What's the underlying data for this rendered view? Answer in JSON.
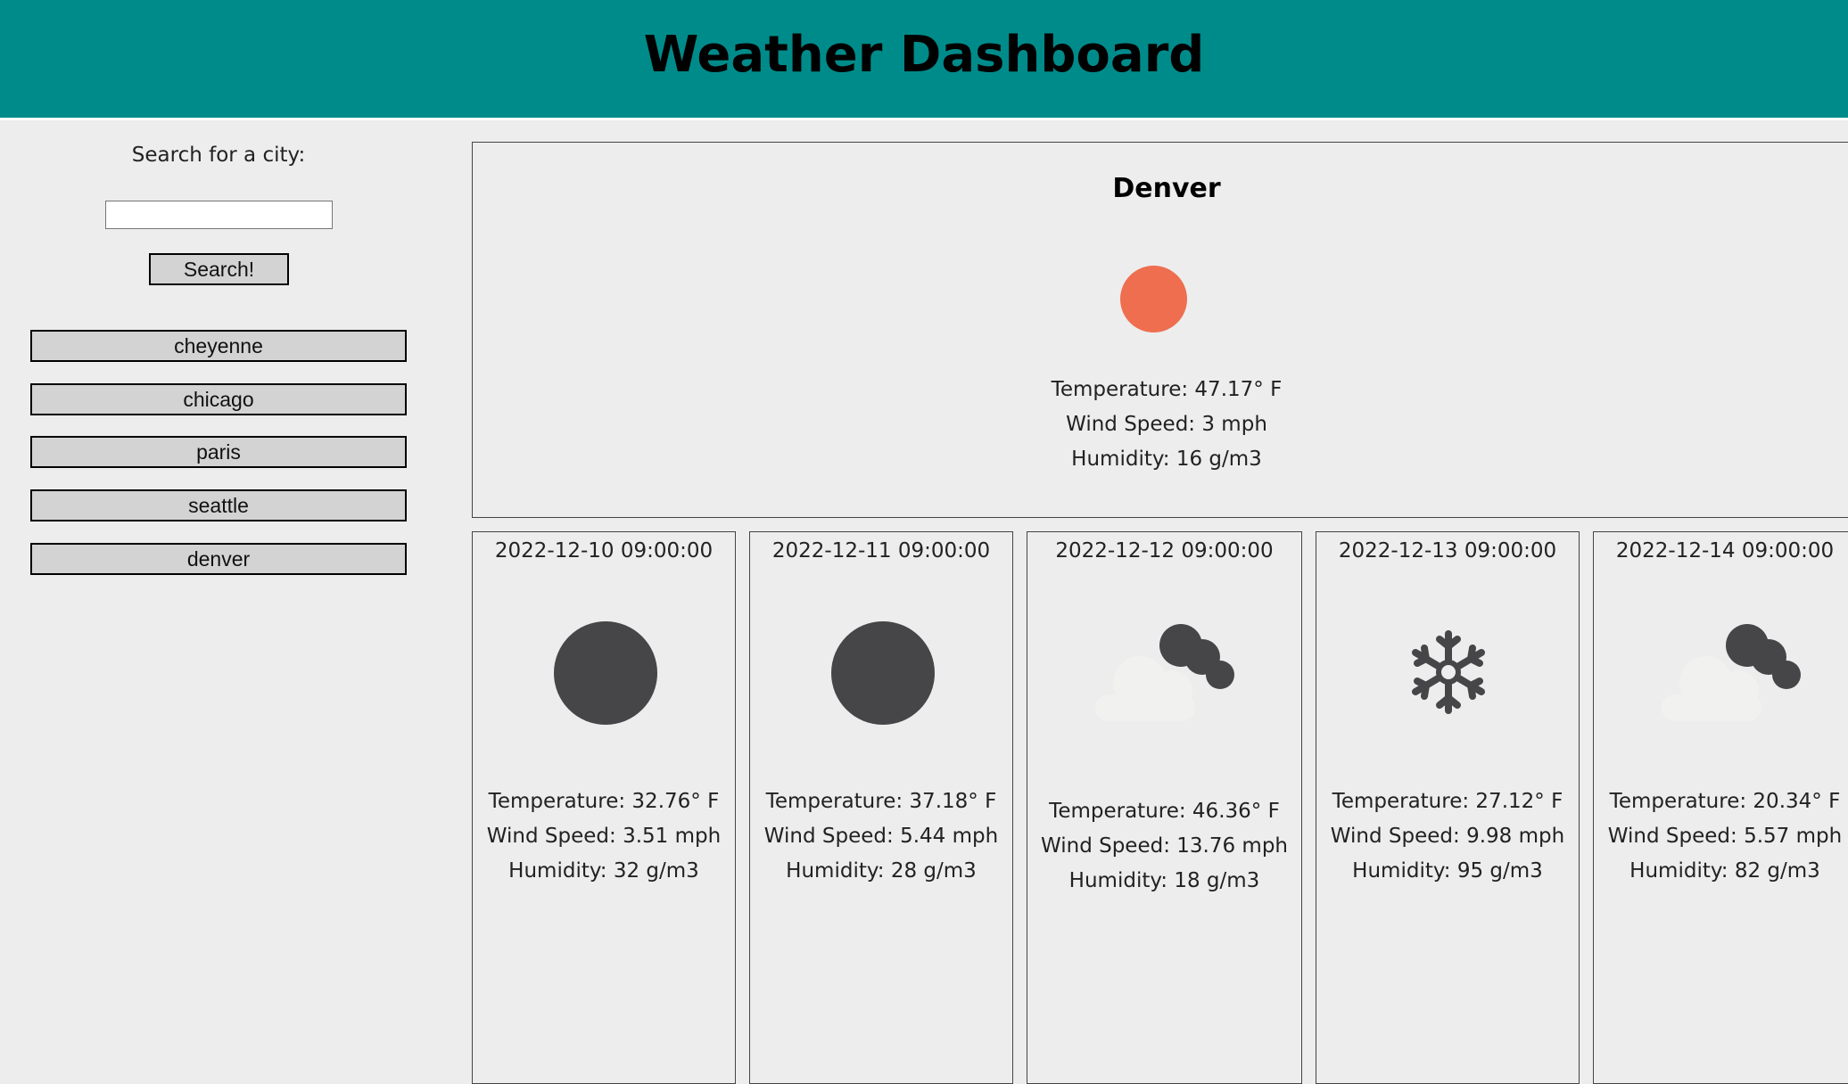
{
  "header": {
    "title": "Weather Dashboard"
  },
  "sidebar": {
    "search_label": "Search for a city:",
    "search_value": "",
    "search_button": "Search!",
    "history": [
      "cheyenne",
      "chicago",
      "paris",
      "seattle",
      "denver"
    ]
  },
  "current": {
    "city": "Denver",
    "icon": "clear-sky-day-icon",
    "icon_color": "#ee6e4f",
    "temperature": "Temperature: 47.17° F",
    "wind": "Wind Speed: 3 mph",
    "humidity": "Humidity: 16 g/m3"
  },
  "forecast": [
    {
      "date": "2022-12-10 09:00:00",
      "icon": "clear-sky-night-icon",
      "temperature": "Temperature: 32.76° F",
      "wind": "Wind Speed: 3.51 mph",
      "humidity": "Humidity: 32 g/m3"
    },
    {
      "date": "2022-12-11 09:00:00",
      "icon": "clear-sky-night-icon",
      "temperature": "Temperature: 37.18° F",
      "wind": "Wind Speed: 5.44 mph",
      "humidity": "Humidity: 28 g/m3"
    },
    {
      "date": "2022-12-12 09:00:00",
      "icon": "partly-cloudy-night-icon",
      "temperature": "Temperature: 46.36° F",
      "wind": "Wind Speed: 13.76 mph",
      "humidity": "Humidity: 18 g/m3"
    },
    {
      "date": "2022-12-13 09:00:00",
      "icon": "snow-icon",
      "temperature": "Temperature: 27.12° F",
      "wind": "Wind Speed: 9.98 mph",
      "humidity": "Humidity: 95 g/m3"
    },
    {
      "date": "2022-12-14 09:00:00",
      "icon": "partly-cloudy-night-icon",
      "temperature": "Temperature: 20.34° F",
      "wind": "Wind Speed: 5.57 mph",
      "humidity": "Humidity: 82 g/m3"
    }
  ]
}
